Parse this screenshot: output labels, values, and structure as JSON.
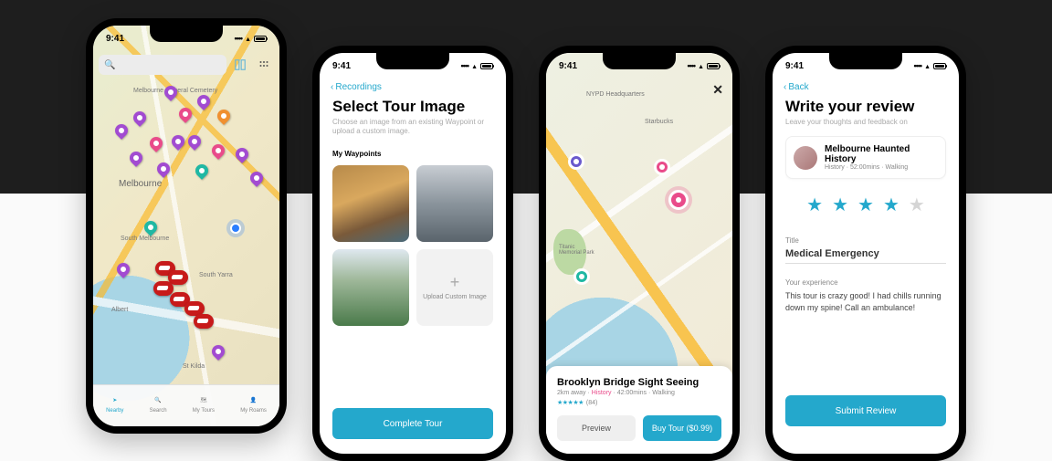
{
  "status_time": "9:41",
  "phone1": {
    "search_placeholder": "Search",
    "labels": {
      "melbourne_general": "Melbourne General Cemetery",
      "melbourne": "Melbourne",
      "south_melbourne": "South Melbourne",
      "south_yarra": "South Yarra",
      "albert": "Albert",
      "st_kilda": "St Kilda"
    },
    "tabs": [
      {
        "label": "Nearby",
        "active": true
      },
      {
        "label": "Search",
        "active": false
      },
      {
        "label": "My Tours",
        "active": false
      },
      {
        "label": "My Roams",
        "active": false
      }
    ]
  },
  "phone2": {
    "back_label": "Recordings",
    "title": "Select Tour Image",
    "subtitle": "Choose an image from an existing Waypoint or upload a custom image.",
    "section": "My Waypoints",
    "upload_label": "Upload Custom Image",
    "cta": "Complete Tour"
  },
  "phone3": {
    "labels": {
      "nypd": "NYPD Headquarters",
      "starbucks": "Starbucks",
      "park": "Titanic Memorial Park"
    },
    "tour_title": "Brooklyn Bridge Sight Seeing",
    "meta_distance": "2km away",
    "meta_category": "History",
    "meta_duration": "42:00mins",
    "meta_mode": "Walking",
    "rating_count": "(84)",
    "preview_btn": "Preview",
    "buy_btn": "Buy Tour ($0.99)"
  },
  "phone4": {
    "back_label": "Back",
    "title": "Write your review",
    "subtitle": "Leave your thoughts and feedback on",
    "tour_name": "Melbourne Haunted History",
    "tour_meta_cat": "History",
    "tour_meta_dur": "52:00mins",
    "tour_meta_mode": "Walking",
    "rating": 4,
    "title_label": "Title",
    "title_value": "Medical Emergency",
    "exp_label": "Your experience",
    "exp_value": "This tour is crazy good! I had chills running down my spine! Call an ambulance!",
    "submit": "Submit Review"
  }
}
